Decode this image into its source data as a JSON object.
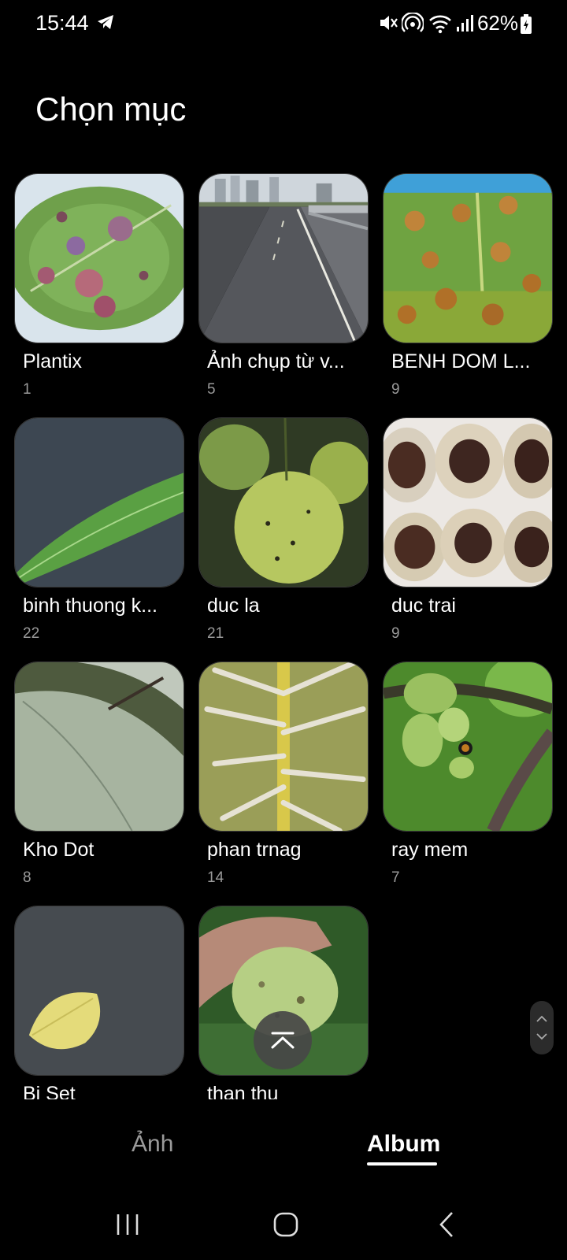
{
  "status_bar": {
    "time": "15:44",
    "battery": "62%",
    "icons": [
      "telegram-icon",
      "mute-icon",
      "hotspot-icon",
      "wifi-icon",
      "signal-icon",
      "battery-icon"
    ]
  },
  "page": {
    "title": "Chọn mục"
  },
  "albums": [
    {
      "name": "Plantix",
      "count": "1"
    },
    {
      "name": "Ảnh chụp từ v...",
      "count": "5"
    },
    {
      "name": "BENH DOM L...",
      "count": "9"
    },
    {
      "name": "binh thuong k...",
      "count": "22"
    },
    {
      "name": "duc la",
      "count": "21"
    },
    {
      "name": "duc trai",
      "count": "9"
    },
    {
      "name": "Kho Dot",
      "count": "8"
    },
    {
      "name": "phan trnag",
      "count": "14"
    },
    {
      "name": "ray mem",
      "count": "7"
    },
    {
      "name": "Bi Set",
      "count": ""
    },
    {
      "name": "than thu",
      "count": ""
    }
  ],
  "tabs": {
    "photos": "Ảnh",
    "album": "Album",
    "selected": "album"
  },
  "colors": {
    "background": "#000000",
    "text": "#ffffff",
    "muted": "#9a9a9a"
  }
}
